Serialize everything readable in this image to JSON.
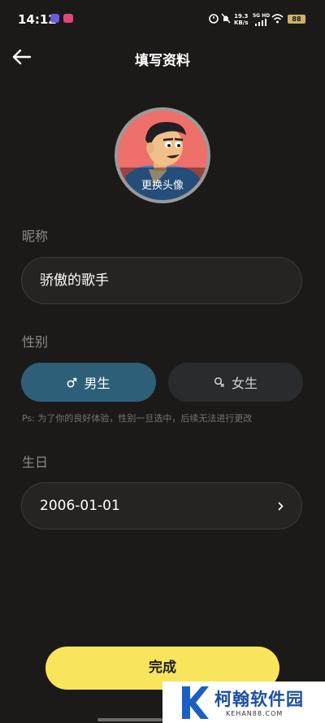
{
  "status_bar": {
    "time": "14:12",
    "speed_value": "19.3",
    "speed_unit": "KB/s",
    "network": "5G HD",
    "battery": "88"
  },
  "header": {
    "title": "填写资料"
  },
  "avatar": {
    "label": "更换头像"
  },
  "nickname": {
    "label": "昵称",
    "value": "骄傲的歌手"
  },
  "gender": {
    "label": "性别",
    "options": [
      {
        "label": "男生",
        "selected": true
      },
      {
        "label": "女生",
        "selected": false
      }
    ],
    "hint": "Ps: 为了你的良好体验，性别一旦选中，后续无法进行更改"
  },
  "birthday": {
    "label": "生日",
    "value": "2006-01-01"
  },
  "submit": {
    "label": "完成"
  },
  "watermark": {
    "name": "柯翰软件园",
    "url": "KEHAN88.COM"
  },
  "colors": {
    "background": "#1c1a19",
    "accent_yellow": "#f8e55c",
    "selected_blue": "#2d5f79"
  }
}
